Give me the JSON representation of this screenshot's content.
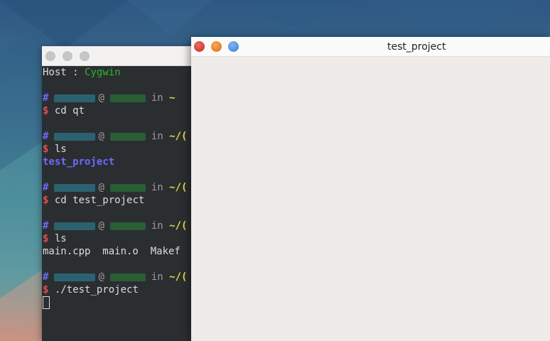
{
  "terminal": {
    "lines": [
      {
        "type": "host",
        "label": "Host : ",
        "value": "Cygwin"
      },
      {
        "type": "blank"
      },
      {
        "type": "prompt-info",
        "hash": "#",
        "at": "@",
        "in": "in",
        "path": "~"
      },
      {
        "type": "command",
        "dollar": "$",
        "text": "cd qt"
      },
      {
        "type": "blank"
      },
      {
        "type": "prompt-info",
        "hash": "#",
        "at": "@",
        "in": "in",
        "path": "~/("
      },
      {
        "type": "command",
        "dollar": "$",
        "text": "ls"
      },
      {
        "type": "dir-output",
        "text": "test_project"
      },
      {
        "type": "blank"
      },
      {
        "type": "prompt-info",
        "hash": "#",
        "at": "@",
        "in": "in",
        "path": "~/("
      },
      {
        "type": "command",
        "dollar": "$",
        "text": "cd test_project"
      },
      {
        "type": "blank"
      },
      {
        "type": "prompt-info",
        "hash": "#",
        "at": "@",
        "in": "in",
        "path": "~/("
      },
      {
        "type": "command",
        "dollar": "$",
        "text": "ls"
      },
      {
        "type": "output",
        "text": "main.cpp  main.o  Makef"
      },
      {
        "type": "blank"
      },
      {
        "type": "prompt-info",
        "hash": "#",
        "at": "@",
        "in": "in",
        "path": "~/("
      },
      {
        "type": "command",
        "dollar": "$",
        "text": "./test_project"
      },
      {
        "type": "cursor"
      }
    ]
  },
  "app_window": {
    "title": "test_project"
  },
  "colors": {
    "host_value": "#2bb52b",
    "hash": "#6b6bff",
    "dollar": "#e05050",
    "path": "#e6d84a",
    "directory": "#6b6bff",
    "close_button": "#d93a2f",
    "minimize_button": "#ef8a2d",
    "maximize_button": "#5a93e3"
  }
}
